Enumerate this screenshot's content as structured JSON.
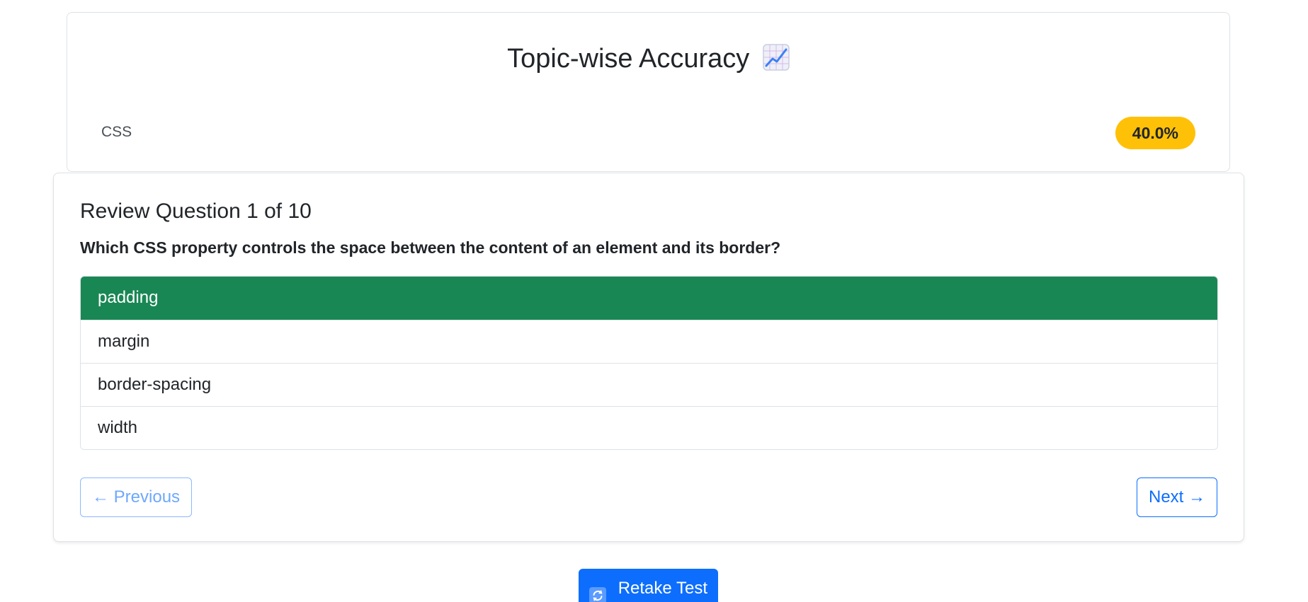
{
  "accuracy": {
    "title": "Topic-wise Accuracy",
    "title_icon": "chart-increasing-icon",
    "topics": [
      {
        "name": "CSS",
        "percent_label": "40.0%",
        "badge_color": "#ffc107"
      }
    ]
  },
  "review": {
    "heading": "Review Question 1 of 10",
    "question": "Which CSS property controls the space between the content of an element and its border?",
    "options": [
      {
        "label": "padding",
        "status": "correct"
      },
      {
        "label": "margin",
        "status": ""
      },
      {
        "label": "border-spacing",
        "status": ""
      },
      {
        "label": "width",
        "status": ""
      }
    ],
    "correct_color": "#198754",
    "previous_label": "← Previous",
    "next_label": "Next →"
  },
  "retake": {
    "icon": "refresh-icon",
    "label": "Retake Test",
    "color": "#0d6efd"
  }
}
